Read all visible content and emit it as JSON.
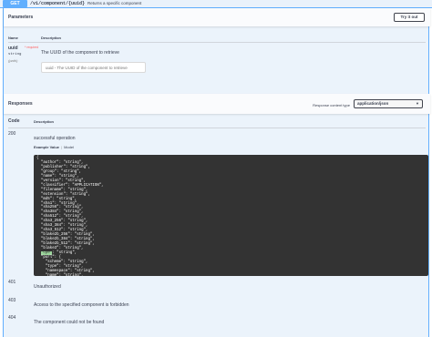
{
  "operation": {
    "method": "GET",
    "path": "/v1/component/{uuid}",
    "summary": "Returns a specific component"
  },
  "parameters": {
    "title": "Parameters",
    "try_out_label": "Try it out",
    "columns": {
      "name": "Name",
      "description": "Description"
    },
    "items": [
      {
        "name": "uuid",
        "required_label": "* required",
        "type": "string",
        "in": "(path)",
        "description": "The UUID of the component to retrieve",
        "placeholder": "uuid - The UUID of the component to retrieve"
      }
    ]
  },
  "responses": {
    "title": "Responses",
    "content_type_label": "Response content type",
    "content_type_value": "application/json",
    "columns": {
      "code": "Code",
      "description": "Description"
    },
    "items": [
      {
        "code": "200",
        "description": "successful operation"
      },
      {
        "code": "401",
        "description": "Unauthorized"
      },
      {
        "code": "403",
        "description": "Access to the specified component is forbidden"
      },
      {
        "code": "404",
        "description": "The component could not be found"
      }
    ],
    "example_tabs": {
      "value": "Example Value",
      "model": "Model"
    },
    "example_lines": [
      "{",
      "  \"author\": \"string\",",
      "  \"publisher\": \"string\",",
      "  \"group\": \"string\",",
      "  \"name\": \"string\",",
      "  \"version\": \"string\",",
      "  \"classifier\": \"APPLICATION\",",
      "  \"filename\": \"string\",",
      "  \"extension\": \"string\",",
      "  \"md5\": \"string\",",
      "  \"sha1\": \"string\",",
      "  \"sha256\": \"string\",",
      "  \"sha384\": \"string\",",
      "  \"sha512\": \"string\",",
      "  \"sha3_256\": \"string\",",
      "  \"sha3_384\": \"string\",",
      "  \"sha3_512\": \"string\",",
      "  \"blake2b_256\": \"string\",",
      "  \"blake2b_384\": \"string\",",
      "  \"blake2b_512\": \"string\",",
      "  \"blake3\": \"string\",",
      "  \"cpe\": \"string\",",
      "  \"purl\": {",
      "    \"scheme\": \"string\",",
      "    \"type\": \"string\",",
      "    \"namespace\": \"string\",",
      "    \"name\": \"string\",",
      "    \"version\": \"string\","
    ]
  }
}
